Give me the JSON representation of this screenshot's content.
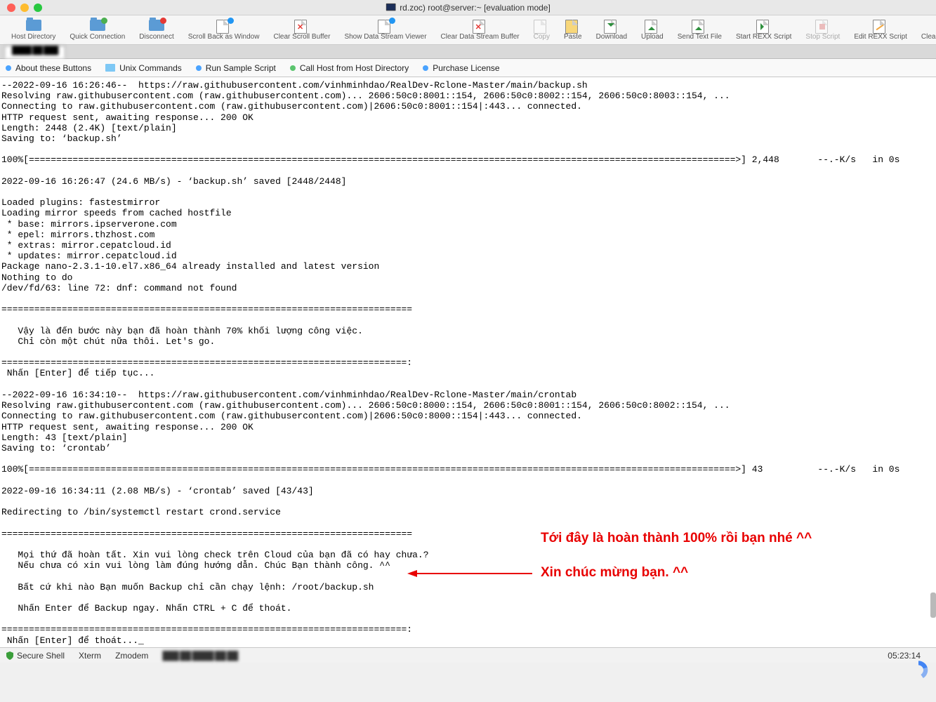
{
  "window": {
    "title": "rd.zoc) root@server:~ [evaluation mode]"
  },
  "toolbar": [
    {
      "id": "host-directory",
      "label": "Host Directory"
    },
    {
      "id": "quick-connection",
      "label": "Quick Connection"
    },
    {
      "id": "disconnect",
      "label": "Disconnect"
    },
    {
      "id": "scroll-back-window",
      "label": "Scroll Back as Window"
    },
    {
      "id": "clear-scroll-buffer",
      "label": "Clear Scroll Buffer"
    },
    {
      "id": "show-data-stream",
      "label": "Show Data Stream Viewer"
    },
    {
      "id": "clear-data-stream",
      "label": "Clear Data Stream Buffer"
    },
    {
      "id": "copy",
      "label": "Copy",
      "disabled": true
    },
    {
      "id": "paste",
      "label": "Paste"
    },
    {
      "id": "download",
      "label": "Download"
    },
    {
      "id": "upload",
      "label": "Upload"
    },
    {
      "id": "send-text-file",
      "label": "Send Text File"
    },
    {
      "id": "start-rexx",
      "label": "Start REXX Script"
    },
    {
      "id": "stop-script",
      "label": "Stop Script",
      "disabled": true
    },
    {
      "id": "edit-rexx",
      "label": "Edit REXX Script"
    },
    {
      "id": "clear-reset",
      "label": "Clear Screen/Reset Terminal"
    }
  ],
  "quickbar": [
    {
      "id": "about-buttons",
      "label": "About these Buttons",
      "dot": "qblue"
    },
    {
      "id": "unix-commands",
      "label": "Unix Commands",
      "folder": true
    },
    {
      "id": "run-sample",
      "label": "Run Sample Script",
      "dot": "qblue"
    },
    {
      "id": "call-host",
      "label": "Call Host from Host Directory",
      "dot": "qgreen"
    },
    {
      "id": "purchase",
      "label": "Purchase License",
      "dot": "qblue"
    }
  ],
  "terminal": {
    "lines": [
      "--2022-09-16 16:26:46--  https://raw.githubusercontent.com/vinhminhdao/RealDev-Rclone-Master/main/backup.sh",
      "Resolving raw.githubusercontent.com (raw.githubusercontent.com)... 2606:50c0:8001::154, 2606:50c0:8002::154, 2606:50c0:8003::154, ...",
      "Connecting to raw.githubusercontent.com (raw.githubusercontent.com)|2606:50c0:8001::154|:443... connected.",
      "HTTP request sent, awaiting response... 200 OK",
      "Length: 2448 (2.4K) [text/plain]",
      "Saving to: ‘backup.sh’",
      "",
      "100%[=================================================================================================================================>] 2,448       --.-K/s   in 0s",
      "",
      "2022-09-16 16:26:47 (24.6 MB/s) - ‘backup.sh’ saved [2448/2448]",
      "",
      "Loaded plugins: fastestmirror",
      "Loading mirror speeds from cached hostfile",
      " * base: mirrors.ipserverone.com",
      " * epel: mirrors.thzhost.com",
      " * extras: mirror.cepatcloud.id",
      " * updates: mirror.cepatcloud.id",
      "Package nano-2.3.1-10.el7.x86_64 already installed and latest version",
      "Nothing to do",
      "/dev/fd/63: line 72: dnf: command not found",
      "",
      "===========================================================================",
      "",
      "   Vậy là đến bước này bạn đã hoàn thành 70% khối lượng công việc.",
      "   Chỉ còn một chút nữa thôi. Let's go.",
      "",
      "==========================================================================:",
      " Nhấn [Enter] để tiếp tục...",
      "",
      "--2022-09-16 16:34:10--  https://raw.githubusercontent.com/vinhminhdao/RealDev-Rclone-Master/main/crontab",
      "Resolving raw.githubusercontent.com (raw.githubusercontent.com)... 2606:50c0:8000::154, 2606:50c0:8001::154, 2606:50c0:8002::154, ...",
      "Connecting to raw.githubusercontent.com (raw.githubusercontent.com)|2606:50c0:8000::154|:443... connected.",
      "HTTP request sent, awaiting response... 200 OK",
      "Length: 43 [text/plain]",
      "Saving to: ‘crontab’",
      "",
      "100%[=================================================================================================================================>] 43          --.-K/s   in 0s",
      "",
      "2022-09-16 16:34:11 (2.08 MB/s) - ‘crontab’ saved [43/43]",
      "",
      "Redirecting to /bin/systemctl restart crond.service",
      "",
      "===========================================================================",
      "",
      "   Mọi thứ đã hoàn tất. Xin vui lòng check trên Cloud của bạn đã có hay chưa.?",
      "   Nếu chưa có xin vui lòng làm đúng hướng dẫn. Chúc Bạn thành công. ^^",
      "",
      "   Bất cứ khi nào Bạn muốn Backup chỉ cần chạy lệnh: /root/backup.sh",
      "",
      "   Nhấn Enter để Backup ngay. Nhấn CTRL + C để thoát.",
      "",
      "==========================================================================:",
      " Nhấn [Enter] để thoát..."
    ]
  },
  "annotation": {
    "line1": "Tới đây là hoàn thành 100% rồi bạn nhé ^^",
    "line2": "Xin chúc mừng bạn. ^^"
  },
  "status": {
    "secure": "Secure Shell",
    "xterm": "Xterm",
    "zmodem": "Zmodem",
    "clock": "05:23:14"
  }
}
